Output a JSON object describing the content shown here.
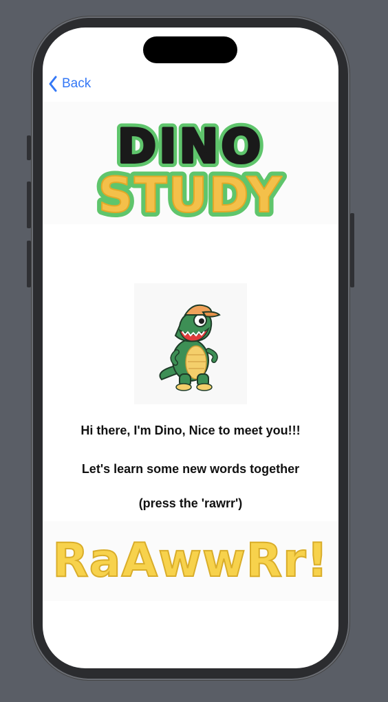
{
  "nav": {
    "back_label": "Back"
  },
  "banner": {
    "line1": "DINO",
    "line2": "STUDY"
  },
  "intro": {
    "greeting": "Hi there, I'm Dino, Nice to meet you!!!",
    "invite": "Let's learn some new words together",
    "hint": "(press the 'rawrr')"
  },
  "rawr_button": {
    "label": "RaAwwRr!"
  },
  "colors": {
    "accent": "#3478f6",
    "banner_green": "#5fc56c",
    "banner_yellow": "#f4c04a",
    "rawr_yellow": "#f7d24c"
  },
  "icons": {
    "back": "chevron-left-icon",
    "mascot": "dino-mascot-icon"
  }
}
